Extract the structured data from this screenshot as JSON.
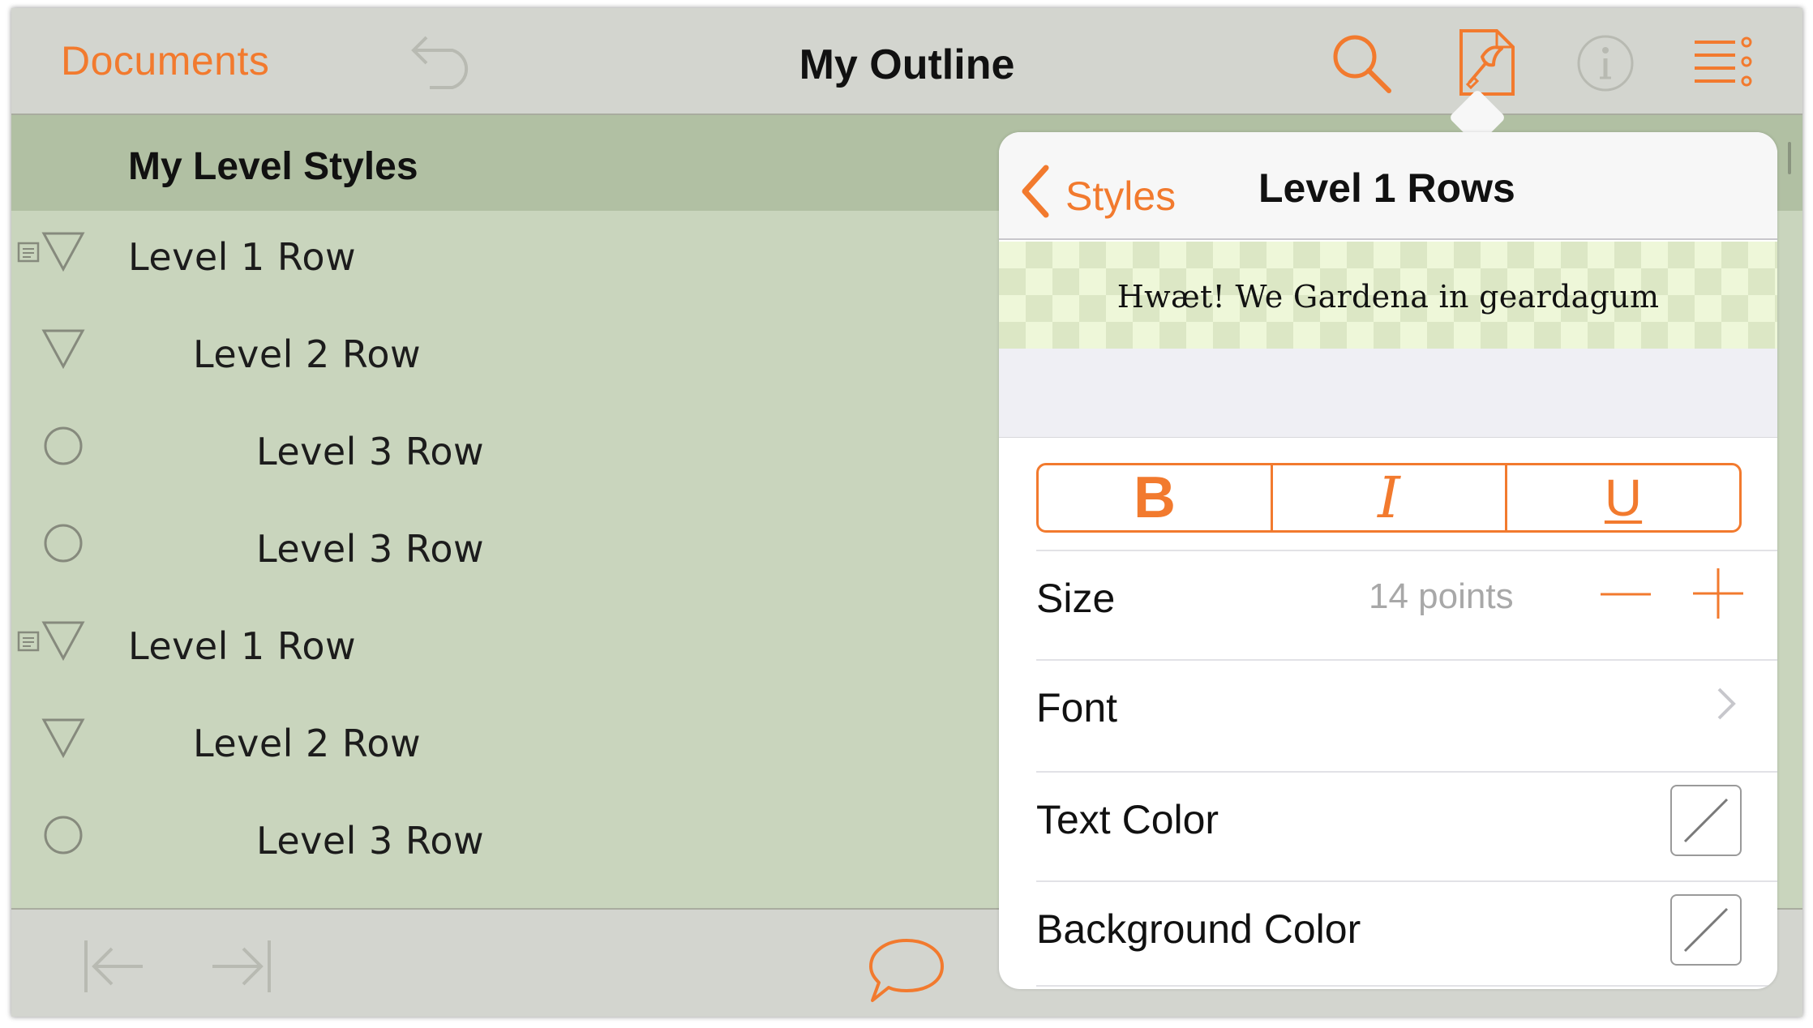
{
  "toolbar": {
    "documents_label": "Documents",
    "title": "My Outline",
    "icons": [
      "undo-icon",
      "search-icon",
      "style-brush-icon",
      "info-icon",
      "menu-list-icon"
    ]
  },
  "header": {
    "title": "My Level Styles"
  },
  "rows": [
    {
      "label": "Level 1 Row",
      "level": 1,
      "has_note": true,
      "handle": "triangle"
    },
    {
      "label": "Level 2 Row",
      "level": 2,
      "has_note": false,
      "handle": "triangle"
    },
    {
      "label": "Level 3 Row",
      "level": 3,
      "has_note": false,
      "handle": "circle"
    },
    {
      "label": "Level 3 Row",
      "level": 3,
      "has_note": false,
      "handle": "circle"
    },
    {
      "label": "Level 1 Row",
      "level": 1,
      "has_note": true,
      "handle": "triangle"
    },
    {
      "label": "Level 2 Row",
      "level": 2,
      "has_note": false,
      "handle": "triangle"
    },
    {
      "label": "Level 3 Row",
      "level": 3,
      "has_note": false,
      "handle": "circle"
    }
  ],
  "popover": {
    "back_label": "Styles",
    "title": "Level 1 Rows",
    "preview_text": "Hwæt! We Gardena in geardagum",
    "bold_label": "B",
    "italic_label": "I",
    "underline_label": "U",
    "size_label": "Size",
    "size_value": "14 points",
    "font_label": "Font",
    "text_color_label": "Text Color",
    "background_color_label": "Background Color"
  },
  "colors": {
    "accent": "#f27a2e",
    "outline_bg": "#c9d5bd",
    "header_bg": "#b1c0a3",
    "toolbar_bg": "#d3d5cf"
  }
}
